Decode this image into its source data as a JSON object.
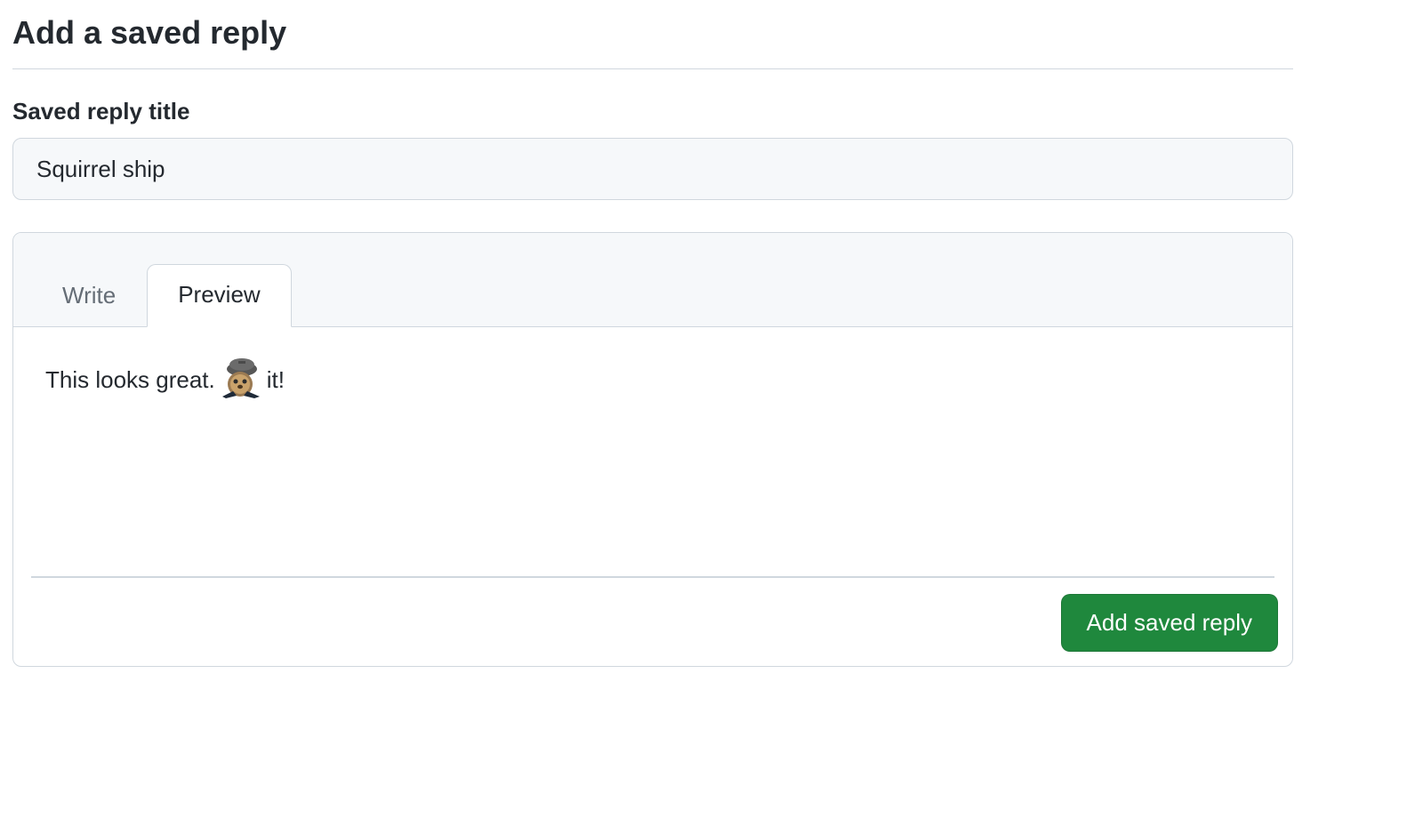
{
  "page": {
    "heading": "Add a saved reply"
  },
  "form": {
    "title_label": "Saved reply title",
    "title_value": "Squirrel ship"
  },
  "editor": {
    "tabs": {
      "write": "Write",
      "preview": "Preview",
      "active": "preview"
    },
    "preview_parts": {
      "before": "This looks great.",
      "emoji": "shipit-squirrel",
      "after": "it!"
    }
  },
  "actions": {
    "submit_label": "Add saved reply"
  }
}
